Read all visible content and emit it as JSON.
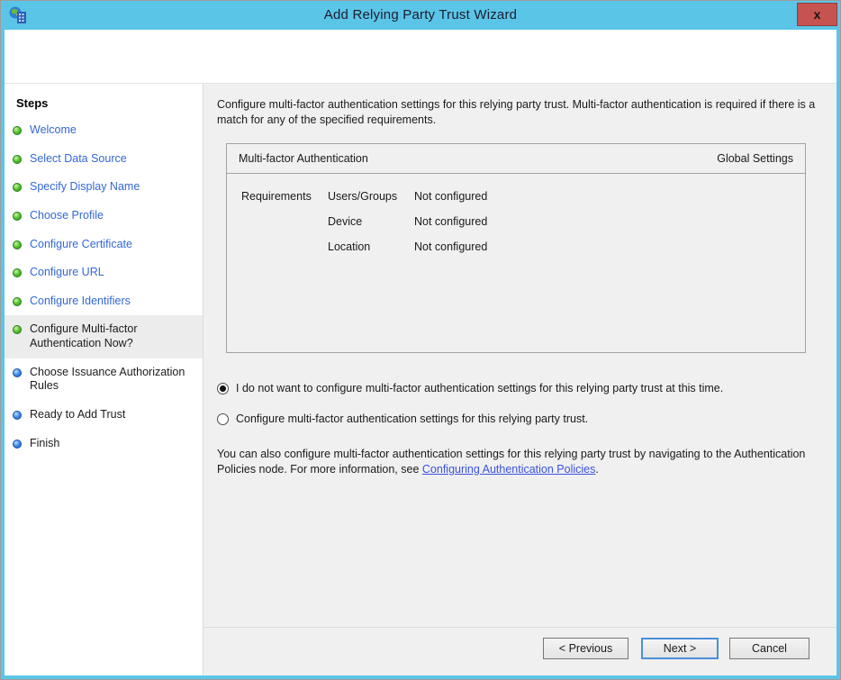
{
  "window": {
    "title": "Add Relying Party Trust Wizard",
    "close_label": "x"
  },
  "sidebar": {
    "header": "Steps",
    "items": [
      {
        "label": "Welcome",
        "state": "done"
      },
      {
        "label": "Select Data Source",
        "state": "done"
      },
      {
        "label": "Specify Display Name",
        "state": "done"
      },
      {
        "label": "Choose Profile",
        "state": "done"
      },
      {
        "label": "Configure Certificate",
        "state": "done"
      },
      {
        "label": "Configure URL",
        "state": "done"
      },
      {
        "label": "Configure Identifiers",
        "state": "done"
      },
      {
        "label": "Configure Multi-factor Authentication Now?",
        "state": "current"
      },
      {
        "label": "Choose Issuance Authorization Rules",
        "state": "pending"
      },
      {
        "label": "Ready to Add Trust",
        "state": "pending"
      },
      {
        "label": "Finish",
        "state": "pending"
      }
    ]
  },
  "content": {
    "intro": "Configure multi-factor authentication settings for this relying party trust. Multi-factor authentication is required if there is a match for any of the specified requirements.",
    "panel": {
      "title": "Multi-factor Authentication",
      "global_label": "Global Settings",
      "requirements_label": "Requirements",
      "rows": [
        {
          "name": "Users/Groups",
          "value": "Not configured"
        },
        {
          "name": "Device",
          "value": "Not configured"
        },
        {
          "name": "Location",
          "value": "Not configured"
        }
      ]
    },
    "radio_options": [
      {
        "label": "I do not want to configure multi-factor authentication settings for this relying party trust at this time.",
        "selected": true
      },
      {
        "label": "Configure multi-factor authentication settings for this relying party trust.",
        "selected": false
      }
    ],
    "footer": {
      "text_before_link": "You can also configure multi-factor authentication settings for this relying party trust by navigating to the Authentication Policies node. For more information, see ",
      "link": "Configuring Authentication Policies",
      "text_after_link": "."
    }
  },
  "buttons": {
    "previous": "< Previous",
    "next": "Next >",
    "cancel": "Cancel"
  },
  "colors": {
    "titlebar": "#5bc5e7",
    "close_button": "#c75351",
    "content_bg": "#f0f0f0",
    "step_link": "#3467d6",
    "hyperlink": "#3a52e0",
    "done_dot": "#3fae29",
    "pending_dot": "#2f7ce0",
    "default_button_border": "#4a90d9"
  }
}
